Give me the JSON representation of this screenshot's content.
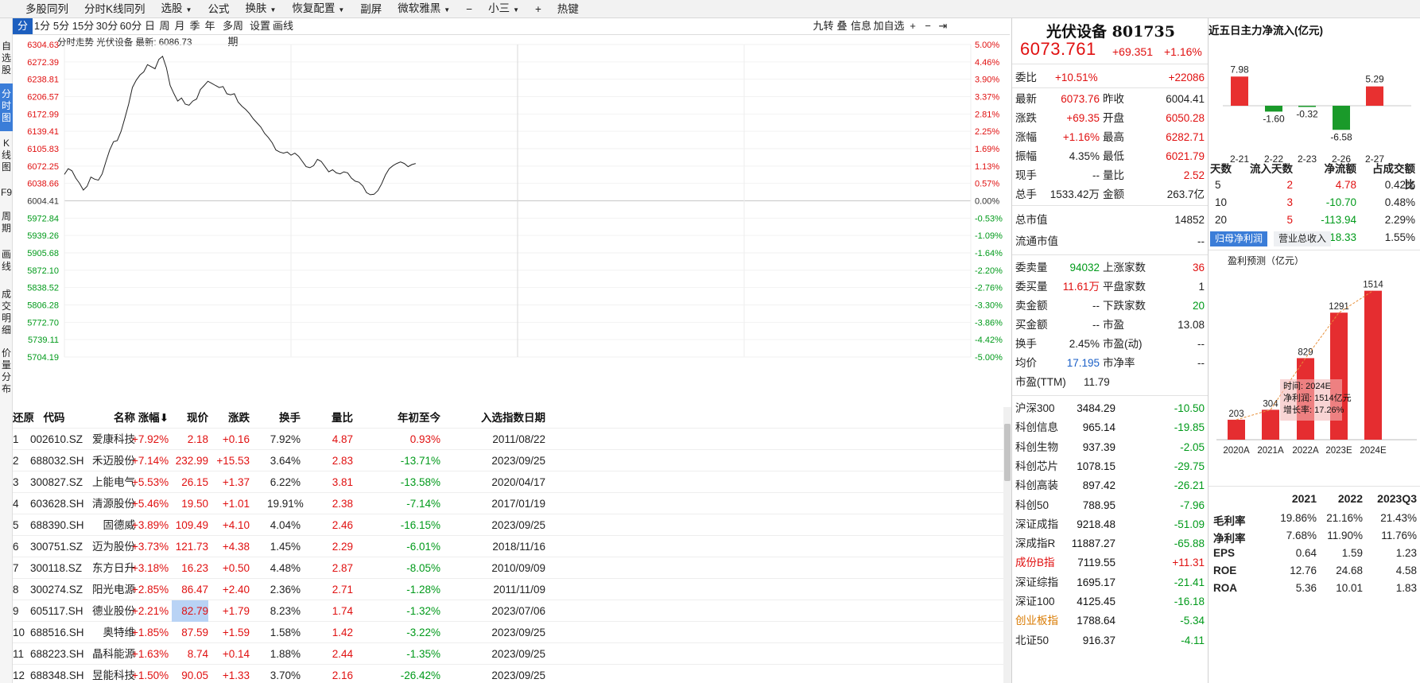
{
  "toolbar": {
    "items": [
      {
        "label": "多股同列",
        "caret": false
      },
      {
        "label": "分时K线同列",
        "caret": false
      },
      {
        "label": "选股",
        "caret": true
      },
      {
        "label": "公式",
        "caret": false
      },
      {
        "label": "换肤",
        "caret": true
      },
      {
        "label": "恢复配置",
        "caret": true
      },
      {
        "label": "副屏",
        "caret": false
      },
      {
        "label": "微软雅黑",
        "caret": true
      },
      {
        "label": "−",
        "caret": false
      },
      {
        "label": "小三",
        "caret": true
      },
      {
        "label": "+",
        "caret": false
      },
      {
        "label": "热键",
        "caret": false
      }
    ]
  },
  "left_tabs": [
    {
      "label": "自选股",
      "active": false
    },
    {
      "label": "分时图",
      "active": true
    },
    {
      "label": "K线图",
      "active": false
    },
    {
      "label": "F9",
      "active": false
    },
    {
      "label": "周期",
      "active": false
    },
    {
      "label": "画线",
      "active": false
    },
    {
      "label": "成交明细",
      "active": false
    },
    {
      "label": "价量分布",
      "active": false
    }
  ],
  "period_tabs": [
    "分时",
    "1分",
    "5分",
    "15分",
    "30分",
    "60分",
    "日",
    "周",
    "月",
    "季",
    "年",
    "多周期",
    "设置",
    "画线"
  ],
  "period_active": "分时",
  "right_tools": [
    "九转",
    "叠",
    "信息",
    "加自选",
    "+",
    "−",
    "⇥"
  ],
  "chart": {
    "title": "分时走势",
    "stock": "光伏设备",
    "latest_label": "最新:",
    "latest": "6086.73",
    "prev_close": 6004.41,
    "y_ticks": [
      "6304.63",
      "6272.39",
      "6238.81",
      "6206.57",
      "6172.99",
      "6139.41",
      "6105.83",
      "6072.25",
      "6038.66",
      "6004.41",
      "5972.84",
      "5939.26",
      "5905.68",
      "5872.10",
      "5838.52",
      "5806.28",
      "5772.70",
      "5739.11",
      "5704.19"
    ],
    "pct_ticks": [
      "5.00%",
      "4.46%",
      "3.90%",
      "3.37%",
      "2.81%",
      "2.25%",
      "1.69%",
      "1.13%",
      "0.57%",
      "0.00%",
      "-0.53%",
      "-1.09%",
      "-1.64%",
      "-2.20%",
      "-2.76%",
      "-3.30%",
      "-3.86%",
      "-4.42%",
      "-5.00%"
    ],
    "price_series": [
      6055,
      6066,
      6062,
      6048,
      6038,
      6025,
      6032,
      6050,
      6046,
      6044,
      6056,
      6080,
      6102,
      6118,
      6120,
      6138,
      6163,
      6190,
      6222,
      6236,
      6246,
      6252,
      6266,
      6262,
      6258,
      6276,
      6282,
      6260,
      6226,
      6210,
      6196,
      6202,
      6190,
      6188,
      6196,
      6200,
      6218,
      6226,
      6234,
      6230,
      6226,
      6222,
      6224,
      6210,
      6208,
      6210,
      6194,
      6186,
      6180,
      6172,
      6162,
      6154,
      6146,
      6134,
      6126,
      6116,
      6102,
      6098,
      6096,
      6098,
      6092,
      6096,
      6090,
      6080,
      6070,
      6068,
      6072,
      6084,
      6080,
      6070,
      6060,
      6064,
      6058,
      6056,
      6060,
      6058,
      6048,
      6042,
      6040,
      6033,
      6020,
      6016,
      6017,
      6024,
      6037,
      6054,
      6066,
      6072,
      6076,
      6079,
      6076,
      6070,
      6074,
      6076
    ]
  },
  "table": {
    "headers": [
      "还原",
      "代码",
      "名称",
      "涨幅",
      "现价",
      "涨跌",
      "换手",
      "量比",
      "年初至今",
      "入选指数日期"
    ],
    "sort_arrow": "⬇",
    "rows": [
      [
        "1",
        "002610.SZ",
        "爱康科技",
        "+7.92%",
        "2.18",
        "+0.16",
        "7.92%",
        "4.87",
        "0.93%",
        "2011/08/22"
      ],
      [
        "2",
        "688032.SH",
        "禾迈股份",
        "+7.14%",
        "232.99",
        "+15.53",
        "3.64%",
        "2.83",
        "-13.71%",
        "2023/09/25"
      ],
      [
        "3",
        "300827.SZ",
        "上能电气",
        "+5.53%",
        "26.15",
        "+1.37",
        "6.22%",
        "3.81",
        "-13.58%",
        "2020/04/17"
      ],
      [
        "4",
        "603628.SH",
        "清源股份",
        "+5.46%",
        "19.50",
        "+1.01",
        "19.91%",
        "2.38",
        "-7.14%",
        "2017/01/19"
      ],
      [
        "5",
        "688390.SH",
        "固德威",
        "+3.89%",
        "109.49",
        "+4.10",
        "4.04%",
        "2.46",
        "-16.15%",
        "2023/09/25"
      ],
      [
        "6",
        "300751.SZ",
        "迈为股份",
        "+3.73%",
        "121.73",
        "+4.38",
        "1.45%",
        "2.29",
        "-6.01%",
        "2018/11/16"
      ],
      [
        "7",
        "300118.SZ",
        "东方日升",
        "+3.18%",
        "16.23",
        "+0.50",
        "4.48%",
        "2.87",
        "-8.05%",
        "2010/09/09"
      ],
      [
        "8",
        "300274.SZ",
        "阳光电源",
        "+2.85%",
        "86.47",
        "+2.40",
        "2.36%",
        "2.71",
        "-1.28%",
        "2011/11/09"
      ],
      [
        "9",
        "605117.SH",
        "德业股份",
        "+2.21%",
        "82.79",
        "+1.79",
        "8.23%",
        "1.74",
        "-1.32%",
        "2023/07/06"
      ],
      [
        "10",
        "688516.SH",
        "奥特维",
        "+1.85%",
        "87.59",
        "+1.59",
        "1.58%",
        "1.42",
        "-3.22%",
        "2023/09/25"
      ],
      [
        "11",
        "688223.SH",
        "晶科能源",
        "+1.63%",
        "8.74",
        "+0.14",
        "1.88%",
        "2.44",
        "-1.35%",
        "2023/09/25"
      ],
      [
        "12",
        "688348.SH",
        "昱能科技",
        "+1.50%",
        "90.05",
        "+1.33",
        "3.70%",
        "2.16",
        "-26.42%",
        "2023/09/25"
      ]
    ]
  },
  "quote": {
    "name": "光伏设备 801735",
    "price": "6073.761",
    "change": "+69.351",
    "change_pct": "+1.16%",
    "wb": {
      "label": "委比",
      "pct": "+10.51%",
      "val": "+22086"
    },
    "pairs": [
      [
        "最新",
        "6073.76",
        "red",
        "昨收",
        "6004.41",
        ""
      ],
      [
        "涨跌",
        "+69.35",
        "red",
        "开盘",
        "6050.28",
        "red"
      ],
      [
        "涨幅",
        "+1.16%",
        "red",
        "最高",
        "6282.71",
        "red"
      ],
      [
        "振幅",
        "4.35%",
        "",
        "最低",
        "6021.79",
        "red"
      ],
      [
        "现手",
        "--",
        "",
        "量比",
        "2.52",
        "red"
      ],
      [
        "总手",
        "1533.42万",
        "",
        "金额",
        "263.7亿",
        ""
      ]
    ],
    "cap": [
      [
        "总市值",
        "14852"
      ],
      [
        "流通市值",
        "--"
      ]
    ],
    "stats": [
      [
        "委卖量",
        "94032",
        "green",
        "上涨家数",
        "36",
        "red"
      ],
      [
        "委买量",
        "11.61万",
        "red",
        "平盘家数",
        "1",
        ""
      ],
      [
        "卖金额",
        "--",
        "",
        "下跌家数",
        "20",
        "green"
      ],
      [
        "买金额",
        "--",
        "",
        "市盈",
        "13.08",
        ""
      ],
      [
        "换手",
        "2.45%",
        "",
        "市盈(动)",
        "--",
        ""
      ],
      [
        "均价",
        "17.195",
        "blue",
        "市净率",
        "--",
        ""
      ]
    ],
    "ttm": {
      "label": "市盈(TTM)",
      "val": "11.79"
    },
    "indices": [
      [
        "沪深300",
        "3484.29",
        "-10.50",
        ""
      ],
      [
        "科创信息",
        "965.14",
        "-19.85",
        ""
      ],
      [
        "科创生物",
        "937.39",
        "-2.05",
        ""
      ],
      [
        "科创芯片",
        "1078.15",
        "-29.75",
        ""
      ],
      [
        "科创高装",
        "897.42",
        "-26.21",
        ""
      ],
      [
        "科创50",
        "788.95",
        "-7.96",
        ""
      ],
      [
        "深证成指",
        "9218.48",
        "-51.09",
        ""
      ],
      [
        "深成指R",
        "11887.27",
        "-65.88",
        ""
      ],
      [
        "成份B指",
        "7119.55",
        "+11.31",
        "red"
      ],
      [
        "深证综指",
        "1695.17",
        "-21.41",
        ""
      ],
      [
        "深证100",
        "4125.45",
        "-16.18",
        ""
      ],
      [
        "创业板指",
        "1788.64",
        "-5.34",
        "orange"
      ],
      [
        "北证50",
        "916.37",
        "-4.11",
        ""
      ]
    ]
  },
  "flow": {
    "title": "近五日主力净流入(亿元)",
    "bars": [
      {
        "date": "2-21",
        "value": 7.98,
        "label": "7.98"
      },
      {
        "date": "2-22",
        "value": -1.6,
        "label": "-1.60"
      },
      {
        "date": "2-23",
        "value": -0.32,
        "label": "-0.32"
      },
      {
        "date": "2-26",
        "value": -6.58,
        "label": "-6.58"
      },
      {
        "date": "2-27",
        "value": 5.29,
        "label": "5.29"
      }
    ],
    "table_headers": [
      "天数",
      "流入天数",
      "净流额",
      "占成交额比"
    ],
    "table_rows": [
      [
        "5",
        "2",
        "4.78",
        "0.42%"
      ],
      [
        "10",
        "3",
        "-10.70",
        "0.48%"
      ],
      [
        "20",
        "5",
        "-113.94",
        "2.29%"
      ],
      [
        "60",
        "18",
        "-218.33",
        "1.55%"
      ]
    ],
    "tabs": [
      "归母净利润",
      "营业总收入"
    ],
    "tab_active": "归母净利润",
    "forecast_title": "盈利预测（亿元）",
    "tooltip": [
      "时间: 2024E",
      "净利润: 1514亿元",
      "增长率: 17.26%"
    ],
    "ratio_headers": [
      "",
      "2021",
      "2022",
      "2023Q3"
    ],
    "ratio_rows": [
      [
        "毛利率",
        "19.86%",
        "21.16%",
        "21.43%"
      ],
      [
        "净利率",
        "7.68%",
        "11.90%",
        "11.76%"
      ],
      [
        "EPS",
        "0.64",
        "1.59",
        "1.23"
      ],
      [
        "ROE",
        "12.76",
        "24.68",
        "4.58"
      ],
      [
        "ROA",
        "5.36",
        "10.01",
        "1.83"
      ]
    ]
  },
  "chart_data": {
    "type": "bar",
    "title": "盈利预测（亿元）",
    "categories": [
      "2020A",
      "2021A",
      "2022A",
      "2023E",
      "2024E"
    ],
    "values": [
      203,
      304,
      829,
      1291,
      1514
    ]
  }
}
